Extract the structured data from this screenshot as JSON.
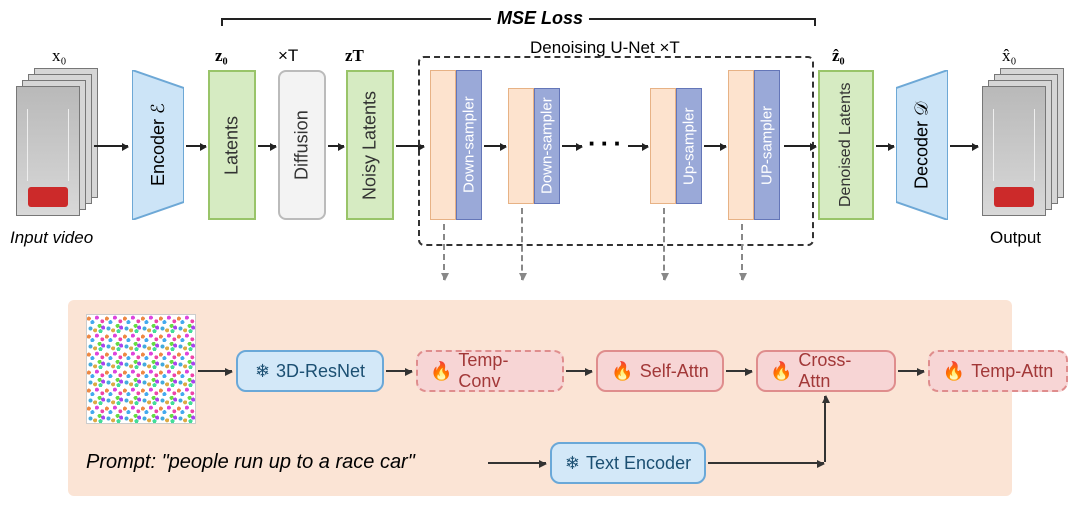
{
  "top": {
    "mse_loss": "MSE Loss",
    "times_T": "×T",
    "unet_label": "Denoising U-Net ×T",
    "x0": "x₀",
    "z0": "z₀",
    "zT": "zT",
    "zhat0": "ẑ₀",
    "xhat0": "x̂₀",
    "input_video": "Input video",
    "output": "Output",
    "dots": "···"
  },
  "blocks": {
    "encoder": "Encoder ℰ",
    "latents": "Latents",
    "diffusion": "Diffusion",
    "noisy_latents": "Noisy Latents",
    "down_sampler": "Down-sampler",
    "up_sampler": "Up-sampler",
    "up_sampler2": "UP-sampler",
    "denoised_latents": "Denoised Latents",
    "decoder": "Decoder 𝒟"
  },
  "panel": {
    "resnet": "3D-ResNet",
    "tempconv": "Temp-Conv",
    "selfattn": "Self-Attn",
    "crossattn": "Cross-Attn",
    "tempattn": "Temp-Attn",
    "textenc": "Text Encoder",
    "prompt_label": "Prompt: ",
    "prompt_text": "\"people run up to a race car\""
  },
  "icons": {
    "frozen": "❄",
    "trainable": "🔥"
  }
}
